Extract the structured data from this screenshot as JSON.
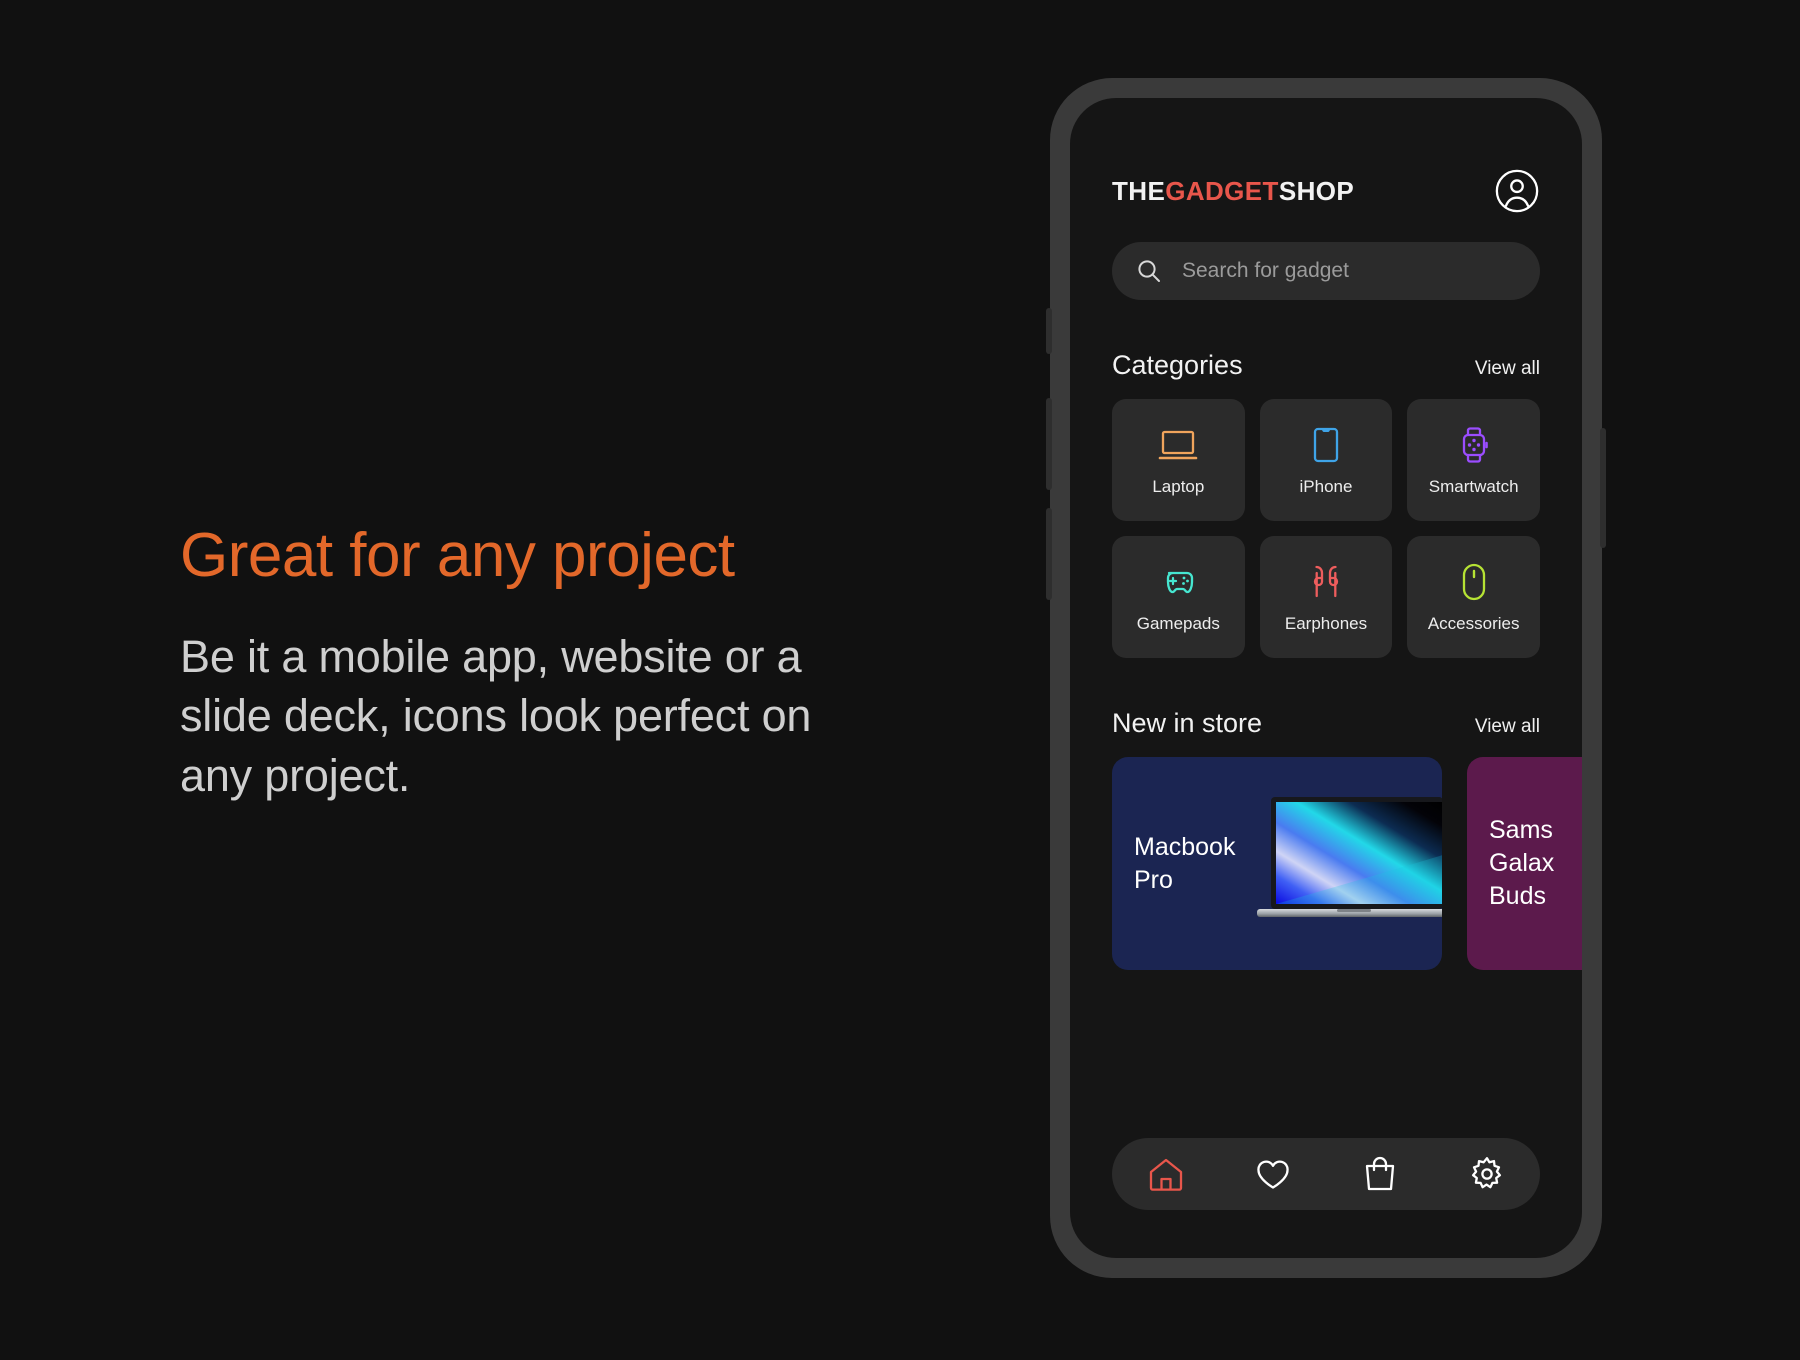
{
  "promo": {
    "heading": "Great for any project",
    "body": "Be it a mobile app, website or a slide deck, icons look perfect on any project.",
    "heading_color": "#E3682A",
    "body_color": "#CFCFCF"
  },
  "app": {
    "brand": {
      "part1": "THE",
      "part2": "GADGET",
      "part3": "SHOP",
      "accent_color": "#E8564B"
    },
    "account_icon": "user-circle-icon",
    "search": {
      "placeholder": "Search for gadget",
      "value": "",
      "icon": "search-icon"
    },
    "sections": [
      {
        "id": "categories",
        "title": "Categories",
        "view_all": "View all"
      },
      {
        "id": "new-in-store",
        "title": "New in store",
        "view_all": "View all"
      }
    ],
    "categories": [
      {
        "label": "Laptop",
        "icon": "laptop-icon",
        "color": "#F0A45C"
      },
      {
        "label": "iPhone",
        "icon": "smartphone-icon",
        "color": "#3FA4E8"
      },
      {
        "label": "Smartwatch",
        "icon": "smartwatch-icon",
        "color": "#9B4DFF"
      },
      {
        "label": "Gamepads",
        "icon": "gamepad-icon",
        "color": "#46E6D0"
      },
      {
        "label": "Earphones",
        "icon": "earbuds-icon",
        "color": "#EE5D5D"
      },
      {
        "label": "Accessories",
        "icon": "mouse-icon",
        "color": "#B6E334"
      }
    ],
    "store_items": [
      {
        "title": "Macbook Pro",
        "bg": "#1B2552",
        "image": "macbook-pro-photo"
      },
      {
        "title": "Samsung Galaxy Buds",
        "bg": "#5C1A4C",
        "truncated_title": "Sams\nGalax\nBuds"
      }
    ],
    "bottom_nav": [
      {
        "label": "Home",
        "icon": "home-icon",
        "active": true,
        "color": "#E8564B"
      },
      {
        "label": "Favorites",
        "icon": "heart-icon",
        "active": false,
        "color": "#FFFFFF"
      },
      {
        "label": "Cart",
        "icon": "shopping-bag-icon",
        "active": false,
        "color": "#FFFFFF"
      },
      {
        "label": "Settings",
        "icon": "gear-icon",
        "active": false,
        "color": "#FFFFFF"
      }
    ]
  }
}
